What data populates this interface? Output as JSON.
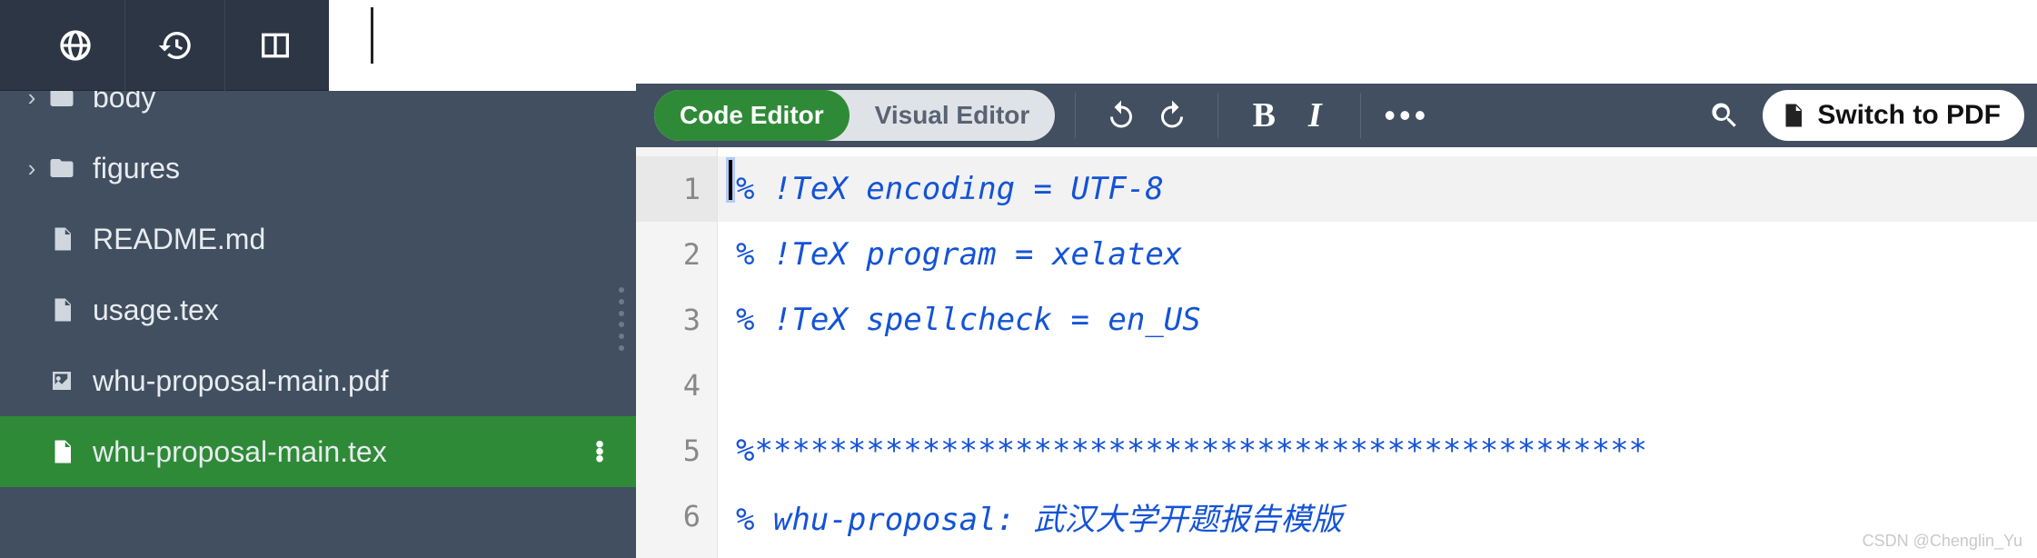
{
  "top_toolbar": {
    "icons": [
      "globe-icon",
      "history-icon",
      "split-view-icon"
    ]
  },
  "sidebar": {
    "items": [
      {
        "name": "body",
        "icon": "folder",
        "expandable": true,
        "truncated_top": true
      },
      {
        "name": "figures",
        "icon": "folder",
        "expandable": true
      },
      {
        "name": "README.md",
        "icon": "file"
      },
      {
        "name": "usage.tex",
        "icon": "file"
      },
      {
        "name": "whu-proposal-main.pdf",
        "icon": "image"
      },
      {
        "name": "whu-proposal-main.tex",
        "icon": "file",
        "selected": true
      }
    ]
  },
  "editor_toolbar": {
    "mode_code_label": "Code Editor",
    "mode_visual_label": "Visual Editor",
    "switch_pdf_label": "Switch to PDF"
  },
  "editor": {
    "lines": [
      "% !TeX encoding = UTF-8",
      "% !TeX program = xelatex",
      "% !TeX spellcheck = en_US",
      "",
      "%************************************************",
      "% whu-proposal: 武汉大学开题报告模版"
    ],
    "current_line_index": 0
  },
  "watermark": "CSDN @Chenglin_Yu"
}
